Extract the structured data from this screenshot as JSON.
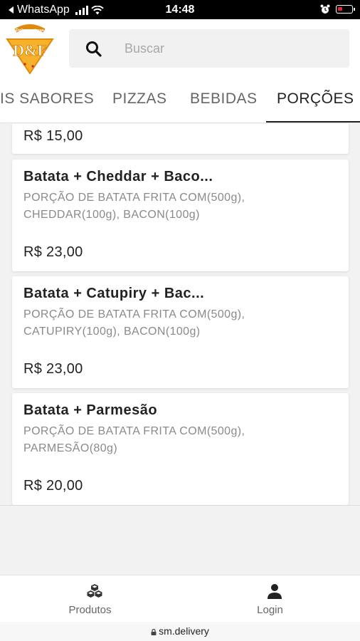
{
  "status_bar": {
    "back_app": "WhatsApp",
    "time": "14:48"
  },
  "header": {
    "logo_text": "D&F",
    "logo_subtext": "Delivery Pizzas",
    "search": {
      "placeholder": "Buscar",
      "value": ""
    }
  },
  "tabs": [
    {
      "label": "IS SABORES",
      "active": false
    },
    {
      "label": "PIZZAS",
      "active": false
    },
    {
      "label": "BEBIDAS",
      "active": false
    },
    {
      "label": "PORÇÕES",
      "active": true
    }
  ],
  "products": [
    {
      "name": "",
      "description": "",
      "price": "R$ 15,00"
    },
    {
      "name": "Batata + Cheddar + Baco...",
      "description": "PORÇÃO DE BATATA FRITA COM(500g), CHEDDAR(100g), BACON(100g)",
      "price": "R$ 23,00"
    },
    {
      "name": "Batata + Catupiry + Bac...",
      "description": "PORÇÃO DE BATATA FRITA COM(500g), CATUPIRY(100g), BACON(100g)",
      "price": "R$ 23,00"
    },
    {
      "name": "Batata + Parmesão",
      "description": "PORÇÃO DE BATATA FRITA COM(500g), PARMESÃO(80g)",
      "price": "R$ 20,00"
    }
  ],
  "bottom_nav": [
    {
      "label": "Produtos",
      "icon": "cubes-icon"
    },
    {
      "label": "Login",
      "icon": "user-icon"
    }
  ],
  "url_bar": {
    "url": "sm.delivery"
  },
  "colors": {
    "accent": "#222222",
    "logo_orange": "#f0a21a"
  }
}
